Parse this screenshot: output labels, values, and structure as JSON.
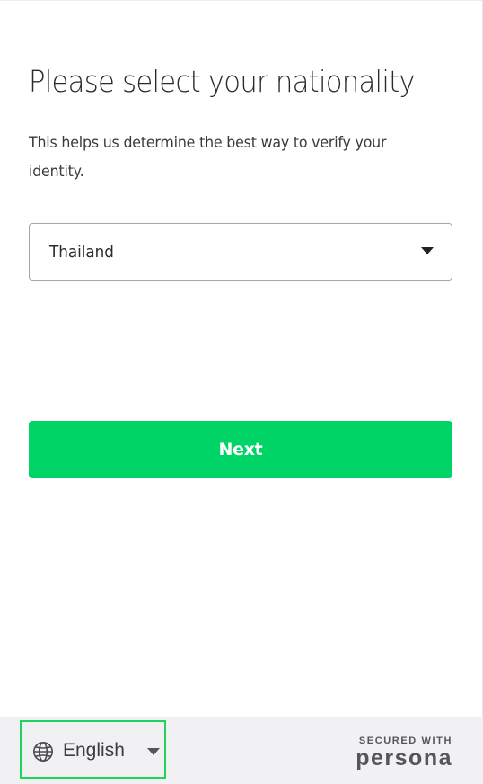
{
  "main": {
    "title": "Please select your nationality",
    "subtitle": "This helps us determine the best way to verify your identity.",
    "nationality_select": {
      "selected_value": "Thailand"
    },
    "next_button_label": "Next"
  },
  "footer": {
    "language_select": {
      "selected_value": "English"
    },
    "secured_with": "SECURED WITH",
    "brand": "persona"
  },
  "colors": {
    "primary_button": "#00d467",
    "focus_outline": "#1fd35c",
    "footer_background": "#f1f1f4"
  },
  "icons": {
    "language": "globe-icon",
    "dropdown": "caret-down-icon"
  }
}
